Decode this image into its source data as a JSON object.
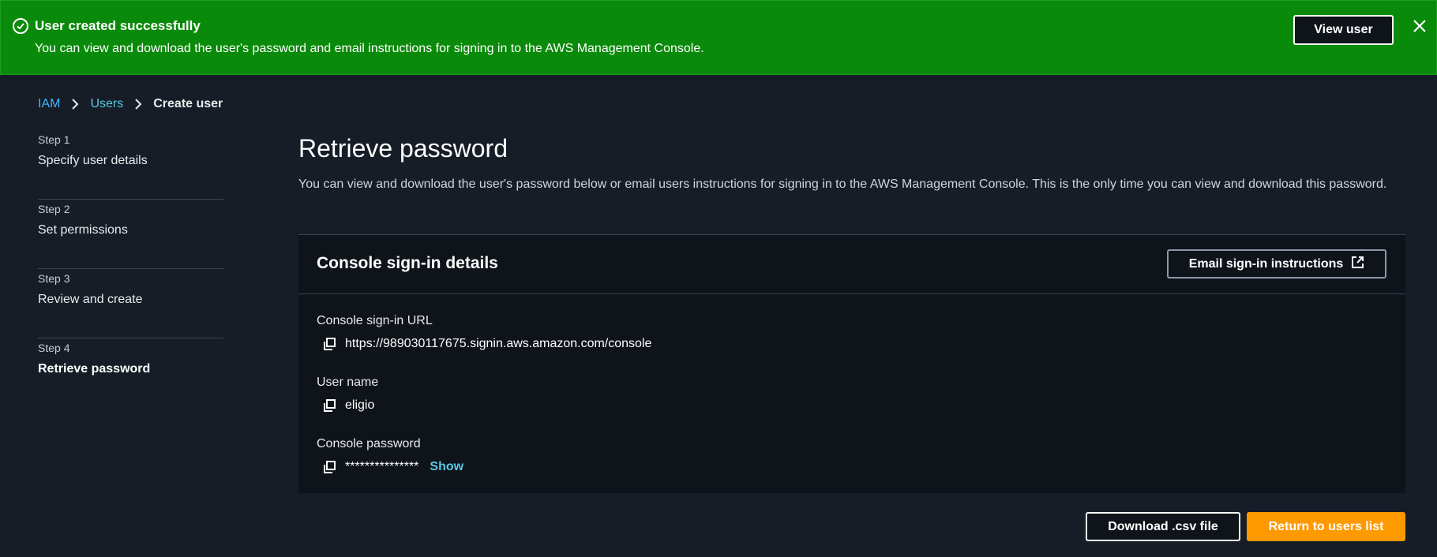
{
  "flash": {
    "title": "User created successfully",
    "message": "You can view and download the user's password and email instructions for signing in to the AWS Management Console.",
    "view_user_label": "View user",
    "icon": "check-circle-icon",
    "background": "#0a8a0a"
  },
  "breadcrumb": {
    "items": [
      "IAM",
      "Users"
    ],
    "current": "Create user"
  },
  "steps": [
    {
      "num": "Step 1",
      "label": "Specify user details"
    },
    {
      "num": "Step 2",
      "label": "Set permissions"
    },
    {
      "num": "Step 3",
      "label": "Review and create"
    },
    {
      "num": "Step 4",
      "label": "Retrieve password"
    }
  ],
  "page": {
    "title": "Retrieve password",
    "description": "You can view and download the user's password below or email users instructions for signing in to the AWS Management Console. This is the only time you can view and download this password."
  },
  "details": {
    "title": "Console sign-in details",
    "email_button": "Email sign-in instructions",
    "url_label": "Console sign-in URL",
    "url_value": "https://989030117675.signin.aws.amazon.com/console",
    "username_label": "User name",
    "username_value": "eligio",
    "password_label": "Console password",
    "password_value": "***************",
    "show_label": "Show"
  },
  "actions": {
    "download_label": "Download .csv file",
    "return_label": "Return to users list",
    "primary_color": "#ff9900"
  }
}
